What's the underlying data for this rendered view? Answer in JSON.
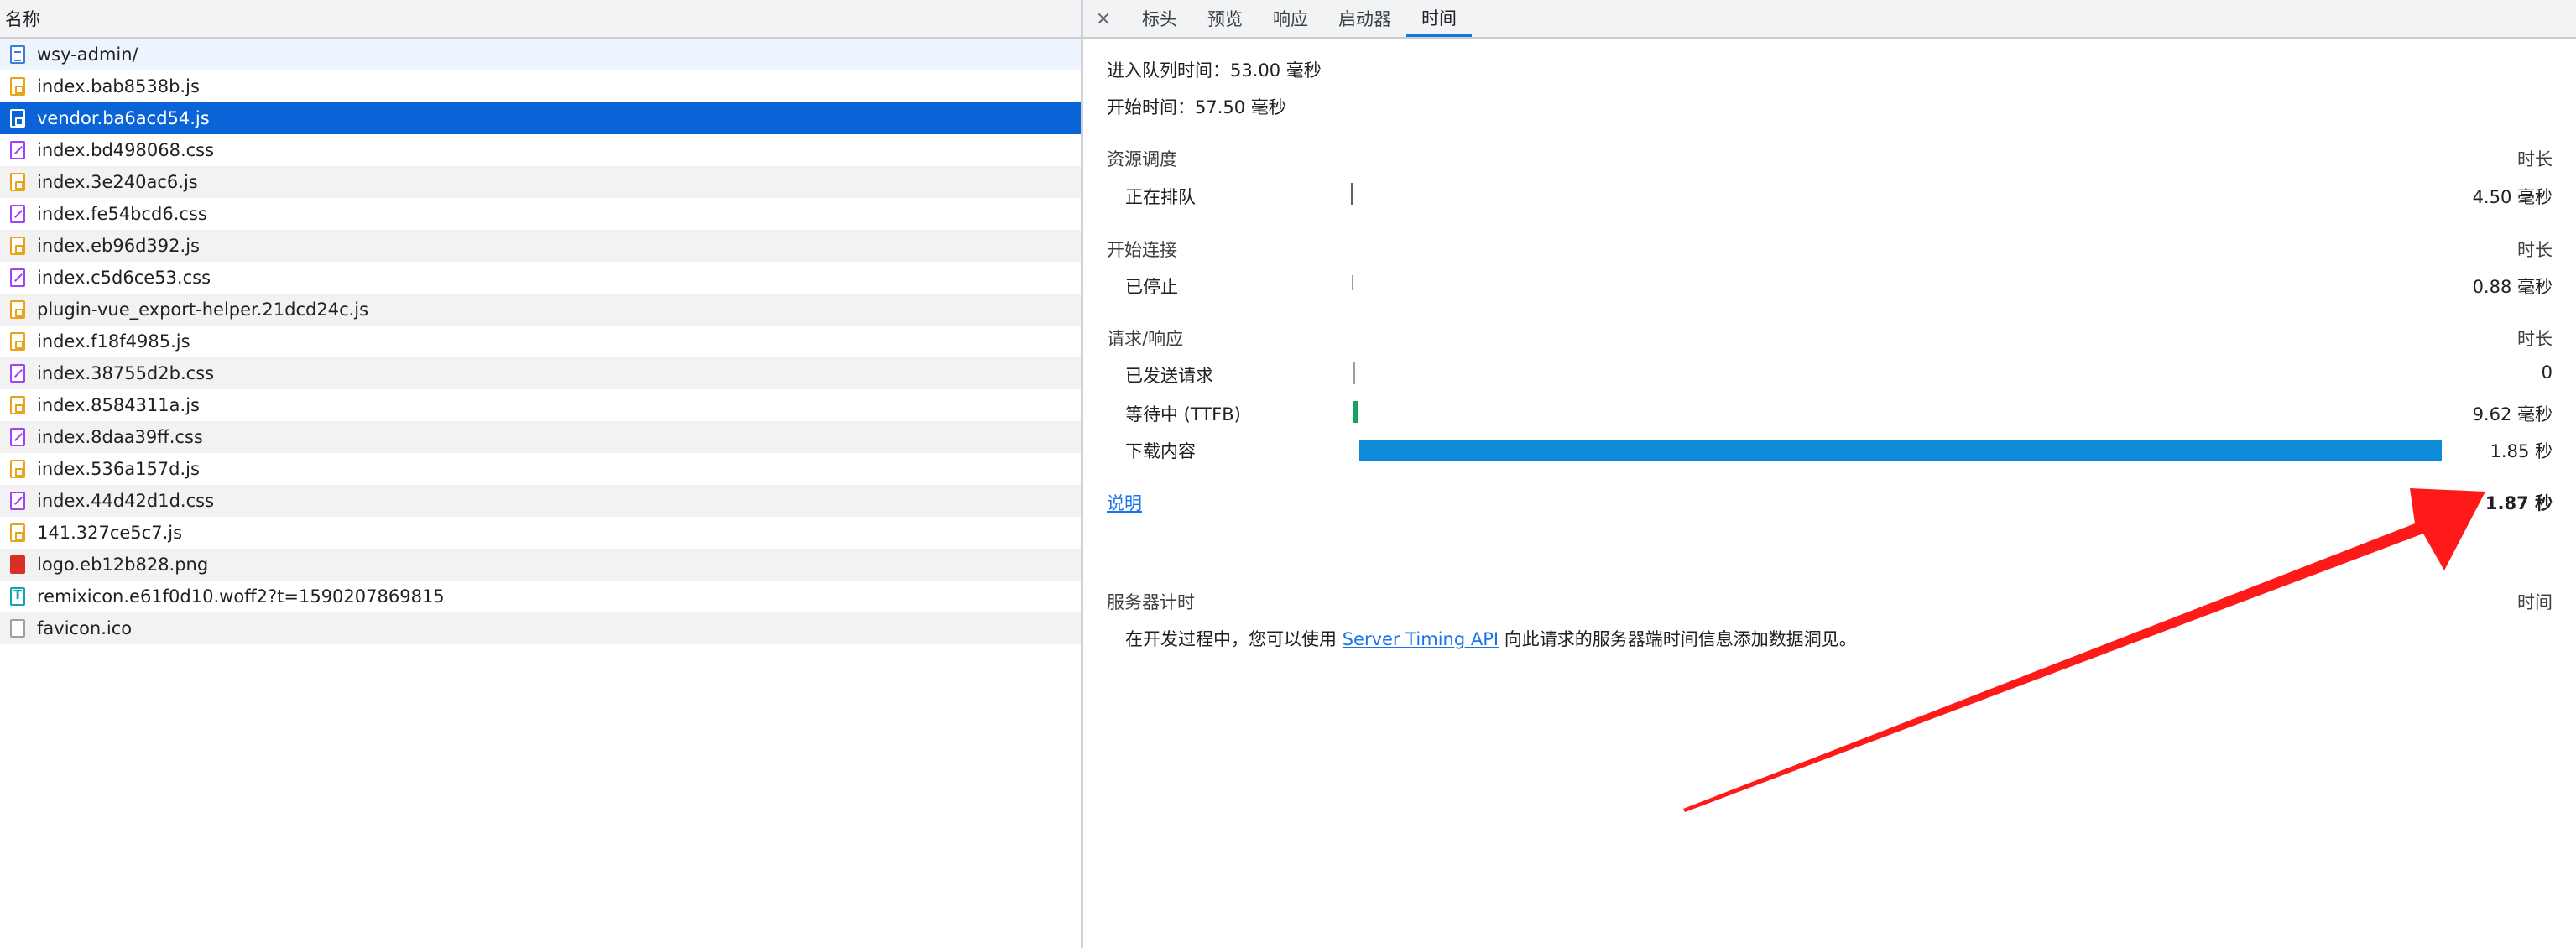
{
  "request_list": {
    "header": "名称",
    "items": [
      {
        "name": "wsy-admin/",
        "type": "doc"
      },
      {
        "name": "index.bab8538b.js",
        "type": "js"
      },
      {
        "name": "vendor.ba6acd54.js",
        "type": "js",
        "selected": true
      },
      {
        "name": "index.bd498068.css",
        "type": "css"
      },
      {
        "name": "index.3e240ac6.js",
        "type": "js"
      },
      {
        "name": "index.fe54bcd6.css",
        "type": "css"
      },
      {
        "name": "index.eb96d392.js",
        "type": "js"
      },
      {
        "name": "index.c5d6ce53.css",
        "type": "css"
      },
      {
        "name": "plugin-vue_export-helper.21dcd24c.js",
        "type": "js"
      },
      {
        "name": "index.f18f4985.js",
        "type": "js"
      },
      {
        "name": "index.38755d2b.css",
        "type": "css"
      },
      {
        "name": "index.8584311a.js",
        "type": "js"
      },
      {
        "name": "index.8daa39ff.css",
        "type": "css"
      },
      {
        "name": "index.536a157d.js",
        "type": "js"
      },
      {
        "name": "index.44d42d1d.css",
        "type": "css"
      },
      {
        "name": "141.327ce5c7.js",
        "type": "js"
      },
      {
        "name": "logo.eb12b828.png",
        "type": "img"
      },
      {
        "name": "remixicon.e61f0d10.woff2?t=1590207869815",
        "type": "font"
      },
      {
        "name": "favicon.ico",
        "type": "other"
      }
    ]
  },
  "tabs": {
    "close": "×",
    "items": [
      "标头",
      "预览",
      "响应",
      "启动器",
      "时间"
    ],
    "active": "时间"
  },
  "timing": {
    "queued_at": "进入队列时间：53.00 毫秒",
    "started_at": "开始时间：57.50 毫秒",
    "resource_scheduling": {
      "title": "资源调度",
      "duration_header": "时长",
      "rows": [
        {
          "label": "正在排队",
          "value": "4.50 毫秒"
        }
      ]
    },
    "connection_start": {
      "title": "开始连接",
      "duration_header": "时长",
      "rows": [
        {
          "label": "已停止",
          "value": "0.88 毫秒"
        }
      ]
    },
    "request_response": {
      "title": "请求/响应",
      "duration_header": "时长",
      "rows": [
        {
          "label": "已发送请求",
          "value": "0"
        },
        {
          "label": "等待中 (TTFB)",
          "value": "9.62 毫秒"
        },
        {
          "label": "下载内容",
          "value": "1.85 秒"
        }
      ]
    },
    "explanation_link": "说明",
    "total": "1.87 秒",
    "server_timing": {
      "title": "服务器计时",
      "time_header": "时间",
      "text_before": "在开发过程中，您可以使用 ",
      "link": "Server Timing API",
      "text_after": " 向此请求的服务器端时间信息添加数据洞见。"
    }
  },
  "colors": {
    "selected_row": "#0a64d8",
    "download_bar": "#0d8bd8",
    "ttfb_bar": "#1aa260",
    "annotation_arrow": "#ff1a1a"
  }
}
